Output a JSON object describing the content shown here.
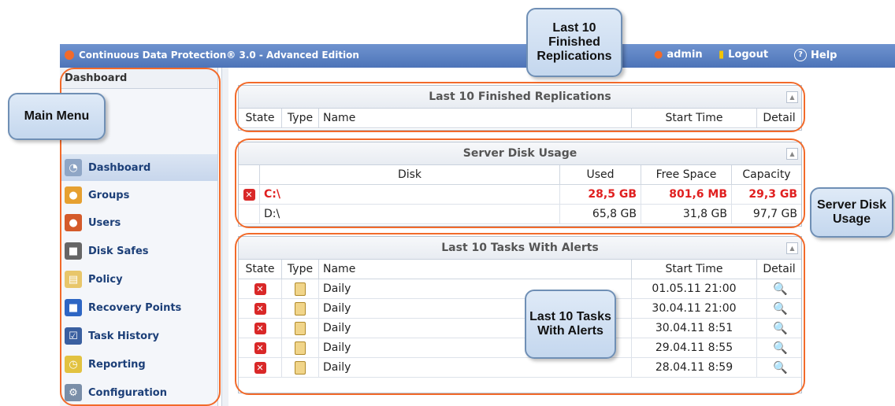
{
  "window": {
    "title": "Continuous Data Protection® 3.0 - Advanced Edition",
    "user": "admin",
    "logout": "Logout",
    "help": "Help"
  },
  "sidebar": {
    "header": "Dashboard",
    "items": [
      {
        "label": "Dashboard",
        "icon": "dashboard-icon",
        "active": true
      },
      {
        "label": "Groups",
        "icon": "groups-icon"
      },
      {
        "label": "Users",
        "icon": "users-icon"
      },
      {
        "label": "Disk Safes",
        "icon": "disk-safe-icon"
      },
      {
        "label": "Policy",
        "icon": "policy-icon"
      },
      {
        "label": "Recovery Points",
        "icon": "recovery-points-icon"
      },
      {
        "label": "Task History",
        "icon": "task-history-icon"
      },
      {
        "label": "Reporting",
        "icon": "reporting-icon"
      },
      {
        "label": "Configuration",
        "icon": "configuration-icon"
      }
    ]
  },
  "replications": {
    "title": "Last 10 Finished Replications",
    "columns": [
      "State",
      "Type",
      "Name",
      "Start Time",
      "Detail"
    ]
  },
  "disk_usage": {
    "title": "Server Disk Usage",
    "columns": [
      "Disk",
      "Used",
      "Free Space",
      "Capacity"
    ],
    "rows": [
      {
        "disk": "C:\\",
        "used": "28,5 GB",
        "free": "801,6 MB",
        "capacity": "29,3 GB",
        "alert": true
      },
      {
        "disk": "D:\\",
        "used": "65,8 GB",
        "free": "31,8 GB",
        "capacity": "97,7 GB",
        "alert": false
      }
    ]
  },
  "alerts": {
    "title": "Last 10 Tasks With Alerts",
    "columns": [
      "State",
      "Type",
      "Name",
      "Start Time",
      "Detail"
    ],
    "rows": [
      {
        "name": "Daily",
        "start": "01.05.11 21:00"
      },
      {
        "name": "Daily",
        "start": "30.04.11 21:00"
      },
      {
        "name": "Daily",
        "start": "30.04.11 8:51"
      },
      {
        "name": "Daily",
        "start": "29.04.11 8:55"
      },
      {
        "name": "Daily",
        "start": "28.04.11 8:59"
      }
    ]
  },
  "callouts": {
    "main_menu": "Main Menu",
    "replications": "Last 10 Finished Replications",
    "disk_usage": "Server Disk Usage",
    "tasks_alerts": "Last 10 Tasks With Alerts"
  },
  "colors": {
    "accent": "#4d74b8",
    "alert": "#e02020",
    "ring": "#f26a2a"
  }
}
